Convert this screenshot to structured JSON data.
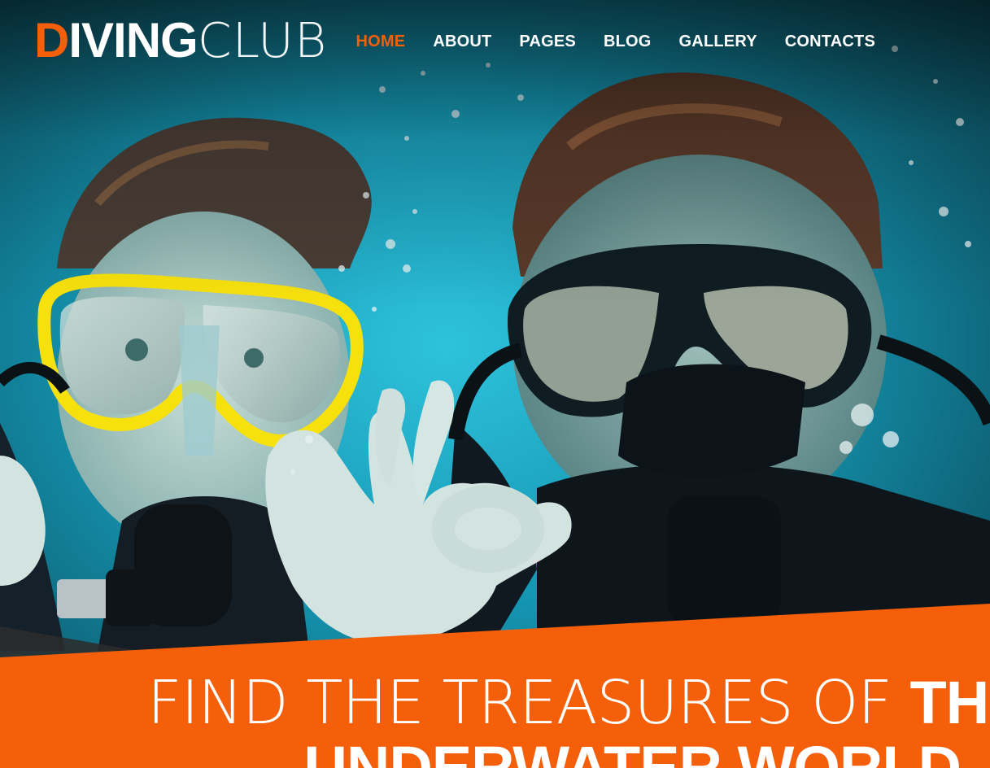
{
  "brand": {
    "logo_first_letter": "D",
    "logo_rest_bold": "IVING",
    "logo_light": "CLUB",
    "accent_color": "#f55f0a"
  },
  "nav": {
    "items": [
      {
        "label": "HOME",
        "active": true
      },
      {
        "label": "ABOUT",
        "active": false
      },
      {
        "label": "PAGES",
        "active": false
      },
      {
        "label": "BLOG",
        "active": false
      },
      {
        "label": "GALLERY",
        "active": false
      },
      {
        "label": "CONTACTS",
        "active": false
      }
    ]
  },
  "hero": {
    "image": "two-scuba-divers-underwater-photo",
    "headline_light": "FIND THE TREASURES OF ",
    "headline_bold_1": "THE",
    "headline_bold_2": "UNDERWATER WORLD"
  },
  "colors": {
    "banner": "#f55f0a",
    "water": "#1aa3c0",
    "text": "#ffffff"
  }
}
